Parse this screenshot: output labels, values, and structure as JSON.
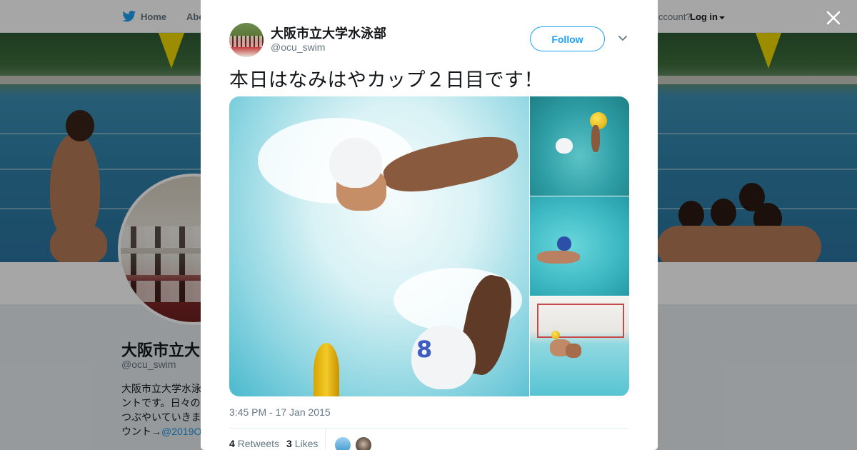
{
  "topnav": {
    "home_label": "Home",
    "about_label": "Abo",
    "account_prompt": "ccount?",
    "login_label": "Log in"
  },
  "profile": {
    "name": "大阪市立大学",
    "handle": "@ocu_swim",
    "bio_lines": [
      "大阪市立大学水泳",
      "ントです。日々の",
      "つぶやいていきま",
      "ウント→"
    ],
    "bio_link": "@2019O"
  },
  "tweet": {
    "author_name": "大阪市立大学水泳部",
    "author_handle": "@ocu_swim",
    "follow_label": "Follow",
    "text": "本日はなみはやカップ２日目です！",
    "timestamp": "3:45 PM - 17 Jan 2015",
    "retweets_count": "4",
    "retweets_label": "Retweets",
    "likes_count": "3",
    "likes_label": "Likes"
  },
  "media": {
    "cap_number": "8"
  },
  "icons": {
    "bird": "twitter-bird-icon",
    "close": "close-icon",
    "chevron": "chevron-down-icon",
    "caret": "caret-down-icon"
  },
  "colors": {
    "accent": "#1da1f2",
    "link": "#1b95e0",
    "text": "#14171a",
    "muted": "#657786"
  }
}
